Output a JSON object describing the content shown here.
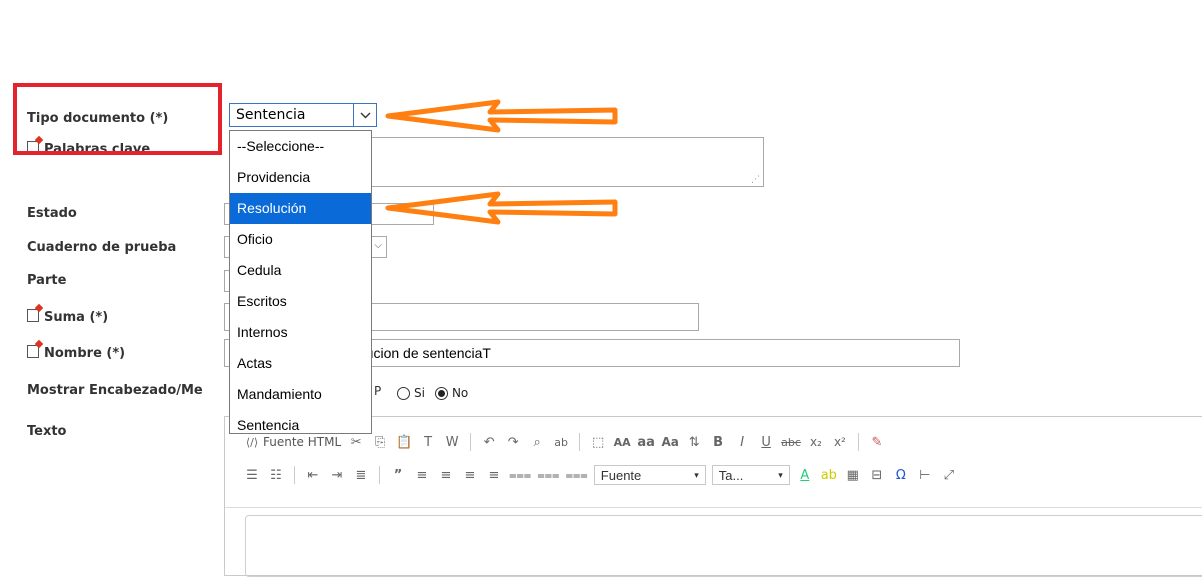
{
  "form": {
    "tipo_documento_label": "Tipo documento (*)",
    "tipo_documento_value": "Sentencia",
    "palabras_clave_label": "Palabras clave",
    "estado_label": "Estado",
    "cuaderno_label": "Cuaderno de prueba",
    "parte_label": "Parte",
    "suma_label": "Suma (*)",
    "nombre_label": "Nombre (*)",
    "nombre_value": "ejecucion de sentenciaT",
    "mostrar_label": "Mostrar Encabezado/Me",
    "mostrar_suffix": "P",
    "radio_si": "Si",
    "radio_no": "No",
    "texto_label": "Texto"
  },
  "dropdown": {
    "options": [
      "--Seleccione--",
      "Providencia",
      "Resolución",
      "Oficio",
      "Cedula",
      "Escritos",
      "Internos",
      "Actas",
      "Mandamiento",
      "Sentencia"
    ],
    "highlighted": "Resolución"
  },
  "editor": {
    "source_label": "Fuente HTML",
    "font_combo": "Fuente",
    "size_combo": "Ta...",
    "heading_labels": [
      "AA",
      "aa",
      "Aa"
    ]
  },
  "colors": {
    "annotation_red": "#e3232e",
    "annotation_orange": "#ff7f11",
    "selection_blue": "#0a6ad8",
    "select_border": "#3b74c2"
  }
}
